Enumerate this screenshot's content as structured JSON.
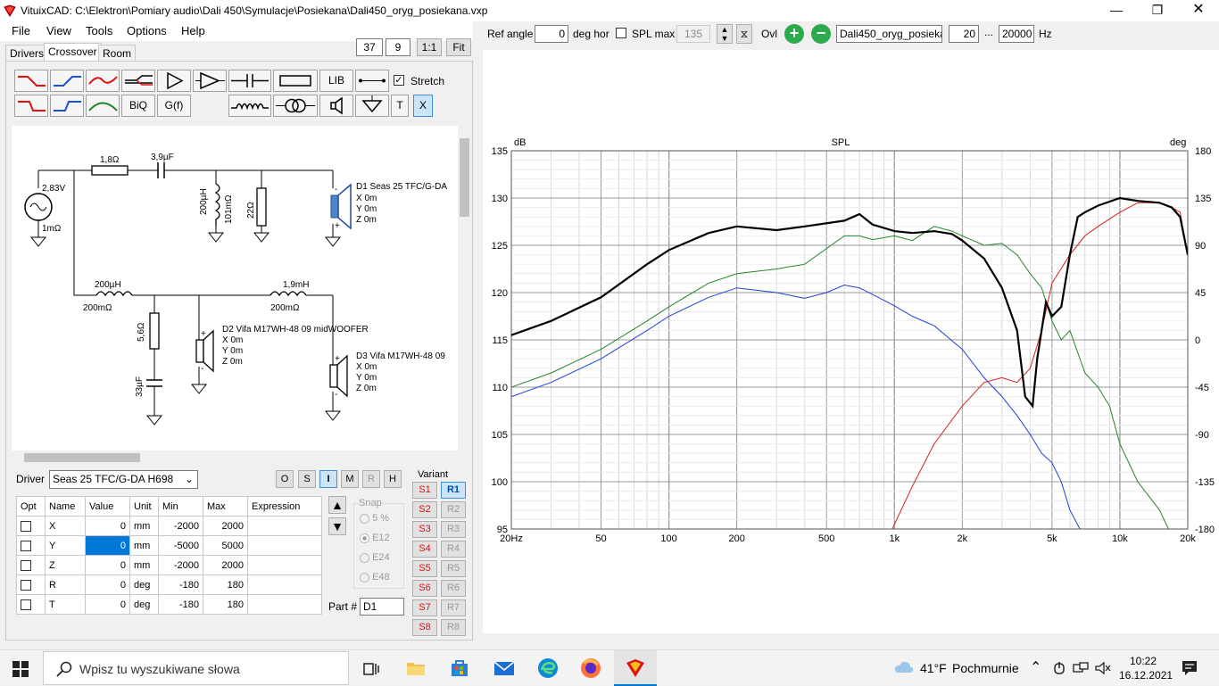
{
  "window": {
    "title": "VituixCAD: C:\\Elektron\\Pomiary audio\\Dali 450\\Symulacje\\Posiekana\\Dali450_oryg_posiekana.vxp"
  },
  "menu": [
    "File",
    "View",
    "Tools",
    "Options",
    "Help"
  ],
  "view_controls": {
    "zoom_a": "37",
    "zoom_b": "9",
    "one_to_one": "1:1",
    "fit": "Fit"
  },
  "tabs": [
    "Drivers",
    "Crossover",
    "Room"
  ],
  "palette": {
    "lib": "LIB",
    "biq": "BiQ",
    "gf": "G(f)",
    "t": "T",
    "x": "X",
    "stretch_label": "Stretch",
    "stretch_checked": true
  },
  "schematic": {
    "source_voltage": "2,83V",
    "source_res": "1mΩ",
    "r1": "1,8Ω",
    "c1": "3,9µF",
    "l1_val": "200µH",
    "l1_res": "101mΩ",
    "r2": "22Ω",
    "d1_name": "D1 Seas 25 TFC/G-DA",
    "d1_x": "X 0m",
    "d1_y": "Y 0m",
    "d1_z": "Z 0m",
    "l2_val": "200µH",
    "l2_res": "200mΩ",
    "l3_val": "1,9mH",
    "l3_res": "200mΩ",
    "r3": "5,6Ω",
    "c2": "33µF",
    "d2_name": "D2 Vifa M17WH-48 09 midWOOFER",
    "d2_x": "X 0m",
    "d2_y": "Y 0m",
    "d2_z": "Z 0m",
    "d3_name": "D3 Vifa M17WH-48 09",
    "d3_x": "X 0m",
    "d3_y": "Y 0m",
    "d3_z": "Z 0m"
  },
  "driver_panel": {
    "driver_label": "Driver",
    "driver_value": "Seas 25 TFC/G-DA H698",
    "mode_buttons": [
      "O",
      "S",
      "I",
      "M",
      "R",
      "H"
    ],
    "columns": [
      "Opt",
      "Name",
      "Value",
      "Unit",
      "Min",
      "Max",
      "Expression"
    ],
    "rows": [
      {
        "name": "X",
        "value": "0",
        "unit": "mm",
        "min": "-2000",
        "max": "2000"
      },
      {
        "name": "Y",
        "value": "0",
        "unit": "mm",
        "min": "-5000",
        "max": "5000"
      },
      {
        "name": "Z",
        "value": "0",
        "unit": "mm",
        "min": "-2000",
        "max": "2000"
      },
      {
        "name": "R",
        "value": "0",
        "unit": "deg",
        "min": "-180",
        "max": "180"
      },
      {
        "name": "T",
        "value": "0",
        "unit": "deg",
        "min": "-180",
        "max": "180"
      }
    ],
    "snap_label": "Snap",
    "snap_options": [
      "5 %",
      "E12",
      "E24",
      "E48"
    ],
    "snap_selected": "E12",
    "part_label": "Part #",
    "part_value": "D1",
    "variant_label": "Variant",
    "variants_s": [
      "S1",
      "S2",
      "S3",
      "S4",
      "S5",
      "S6",
      "S7",
      "S8"
    ],
    "variants_r": [
      "R1",
      "R2",
      "R3",
      "R4",
      "R5",
      "R6",
      "R7",
      "R8"
    ]
  },
  "toolbar": {
    "ref_angle_label": "Ref angle",
    "ref_angle_value": "0",
    "deg_hor": "deg hor",
    "spl_max_label": "SPL max",
    "spl_max_value": "135",
    "ovl_label": "Ovl",
    "project": "Dali450_oryg_posiekana",
    "f_min": "20",
    "f_sep": "...",
    "f_max": "20000",
    "hz": "Hz"
  },
  "chart_data": {
    "type": "line",
    "title": "SPL",
    "ylabel_left": "dB",
    "ylabel_right": "deg",
    "x_scale": "log",
    "xlim": [
      20,
      20000
    ],
    "ylim": [
      95,
      135
    ],
    "y2lim": [
      -180,
      180
    ],
    "x_ticks": [
      "20Hz",
      "50",
      "100",
      "200",
      "500",
      "1k",
      "2k",
      "5k",
      "10k",
      "20k"
    ],
    "y_ticks": [
      "95",
      "100",
      "105",
      "110",
      "115",
      "120",
      "125",
      "130",
      "135"
    ],
    "y2_ticks": [
      "-180",
      "-135",
      "-90",
      "-45",
      "0",
      "45",
      "90",
      "135",
      "180"
    ],
    "series": [
      {
        "color": "#000000",
        "x": [
          20,
          30,
          50,
          80,
          100,
          150,
          200,
          300,
          400,
          600,
          700,
          800,
          1000,
          1200,
          1500,
          1800,
          2000,
          2500,
          3000,
          3500,
          3800,
          4100,
          4300,
          4700,
          5000,
          5500,
          6000,
          6500,
          7000,
          8000,
          10000,
          12000,
          15000,
          17000,
          18500,
          20000
        ],
        "y": [
          115.5,
          117,
          119.5,
          123,
          124.5,
          126.3,
          127,
          126.6,
          127,
          127.6,
          128.3,
          127.2,
          126.5,
          126.3,
          126.5,
          126.2,
          125.5,
          123.6,
          120.5,
          116,
          109,
          108,
          113,
          119,
          117.5,
          118.5,
          124,
          128,
          128.5,
          129.2,
          130,
          129.7,
          129.5,
          129,
          128,
          124
        ]
      },
      {
        "color": "#22862a",
        "x": [
          20,
          30,
          50,
          80,
          100,
          150,
          200,
          300,
          400,
          600,
          700,
          800,
          1000,
          1200,
          1500,
          1800,
          2000,
          2500,
          3000,
          3500,
          4000,
          4500,
          5000,
          5500,
          6000,
          7000,
          8000,
          9000,
          10000,
          12000,
          15000,
          18000,
          20000
        ],
        "y": [
          110,
          111.5,
          114,
          117,
          118.5,
          121,
          122,
          122.5,
          123,
          126,
          126,
          125.6,
          126,
          125.5,
          127,
          126.5,
          126,
          125,
          125.2,
          124,
          122,
          120.5,
          117,
          115,
          116,
          111.5,
          110,
          108,
          104,
          100,
          97,
          93,
          90
        ]
      },
      {
        "color": "#1f3fd4",
        "x": [
          20,
          30,
          50,
          80,
          100,
          150,
          200,
          300,
          400,
          500,
          600,
          700,
          800,
          1000,
          1200,
          1500,
          2000,
          2500,
          3000,
          3500,
          4000,
          4500,
          5000,
          5500,
          6000,
          7000,
          8000,
          10000,
          12000,
          15000,
          20000
        ],
        "y": [
          109,
          110.5,
          113,
          116,
          117.5,
          119.5,
          120.5,
          120,
          119.4,
          120,
          120.8,
          120.5,
          119.8,
          118.6,
          117.5,
          116.5,
          114,
          111,
          109,
          107,
          105,
          103,
          102,
          100,
          97,
          94,
          92,
          88,
          85,
          82,
          78
        ]
      },
      {
        "color": "#d4201a",
        "x": [
          900,
          1000,
          1200,
          1500,
          2000,
          2500,
          3000,
          3500,
          4000,
          4500,
          5000,
          6000,
          7000,
          8000,
          10000,
          12000,
          15000,
          17000,
          18500,
          20000
        ],
        "y": [
          93,
          95.5,
          99.5,
          104,
          108,
          110.5,
          111,
          110.5,
          112,
          116,
          121,
          124,
          126,
          127,
          128.5,
          129.5,
          129.5,
          129,
          128.5,
          124
        ]
      }
    ]
  },
  "taskbar": {
    "search_placeholder": "Wpisz tu wyszukiwane słowa",
    "weather_temp": "41°F",
    "weather_desc": "Pochmurnie",
    "time": "10:22",
    "date": "16.12.2021"
  }
}
